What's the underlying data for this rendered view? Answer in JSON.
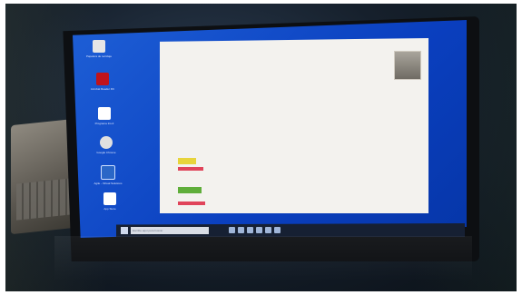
{
  "desktop_icons": [
    {
      "label": "Papelera de reciclaje",
      "color": "#e6e6e6"
    },
    {
      "label": "Acrobat Reader DC",
      "color": "#c0131b"
    },
    {
      "label": "Programa 1G-II",
      "color": "#ffffff"
    },
    {
      "label": "Google Chrome",
      "color": "#e0e0e0"
    },
    {
      "label": "Agile - Virtual Solutions",
      "color": "#2a67c7"
    },
    {
      "label": "App Store",
      "color": "#ffffff"
    }
  ],
  "taskbar": {
    "search_placeholder": "Escribe aquí para buscar"
  }
}
